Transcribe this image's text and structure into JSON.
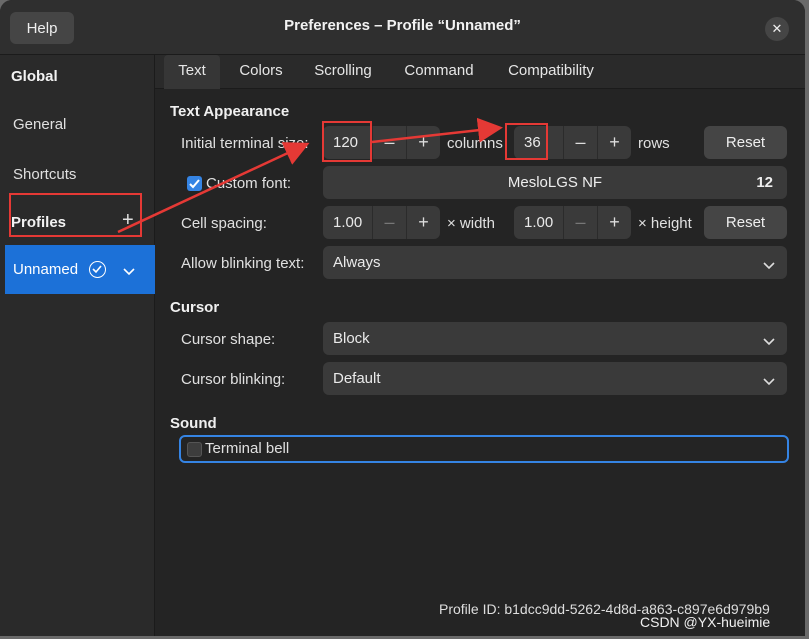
{
  "titlebar": {
    "help_label": "Help",
    "title": "Preferences – Profile “Unnamed”",
    "close_glyph": "✕"
  },
  "sidebar": {
    "global_heading": "Global",
    "general_label": "General",
    "shortcuts_label": "Shortcuts",
    "profiles_heading": "Profiles",
    "add_glyph": "+",
    "selected_profile": "Unnamed"
  },
  "tabs": [
    "Text",
    "Colors",
    "Scrolling",
    "Command",
    "Compatibility"
  ],
  "text_appearance": {
    "heading": "Text Appearance",
    "size_label": "Initial terminal size:",
    "columns_value": "120",
    "columns_unit": "columns",
    "rows_value": "36",
    "rows_unit": "rows",
    "reset_label": "Reset",
    "custom_font_label": "Custom font:",
    "custom_font_checked": true,
    "font_name": "MesloLGS NF",
    "font_size": "12",
    "cell_spacing_label": "Cell spacing:",
    "width_value": "1.00",
    "width_unit": "× width",
    "height_value": "1.00",
    "height_unit": "× height",
    "reset2_label": "Reset",
    "blink_text_label": "Allow blinking text:",
    "blink_text_value": "Always"
  },
  "cursor": {
    "heading": "Cursor",
    "shape_label": "Cursor shape:",
    "shape_value": "Block",
    "blinking_label": "Cursor blinking:",
    "blinking_value": "Default"
  },
  "sound": {
    "heading": "Sound",
    "bell_label": "Terminal bell",
    "bell_checked": false
  },
  "stepper": {
    "minus": "–",
    "plus": "+"
  },
  "footer": {
    "profile_id": "Profile ID:  b1dcc9dd-5262-4d8d-a863-c897e6d979b9"
  },
  "watermark": "CSDN @YX-hueimie",
  "colors": {
    "accent": "#1c71d8",
    "highlight": "#e53935",
    "window_bg": "#242424"
  }
}
